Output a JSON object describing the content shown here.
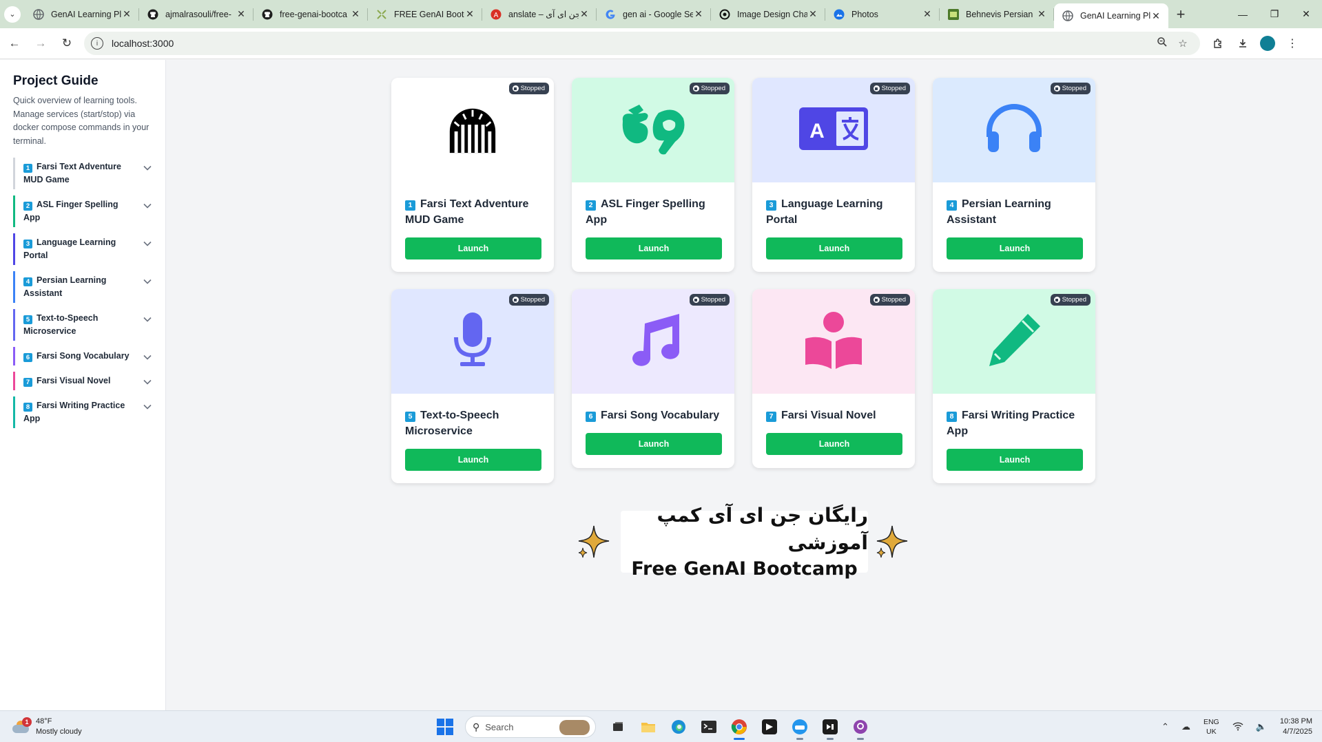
{
  "browser": {
    "tabs": [
      {
        "title": "GenAI Learning Pl",
        "favicon": "globe-icon",
        "color": "#5f6368"
      },
      {
        "title": "ajmalrasouli/free-",
        "favicon": "github-icon",
        "color": "#1f1f1f"
      },
      {
        "title": "free-genai-bootca",
        "favicon": "github-icon",
        "color": "#1f1f1f"
      },
      {
        "title": "FREE GenAI Bootc",
        "favicon": "puzzle-icon",
        "color": "#8aa84e"
      },
      {
        "title": "anslate – جن ای آی",
        "favicon": "translate-icon",
        "color": "#d93025"
      },
      {
        "title": "gen ai - Google Se",
        "favicon": "google-icon",
        "color": "#4285f4"
      },
      {
        "title": "Image Design Cha",
        "favicon": "openai-icon",
        "color": "#111111"
      },
      {
        "title": "Photos",
        "favicon": "photos-icon",
        "color": "#1a73e8"
      },
      {
        "title": "Behnevis Persian",
        "favicon": "behnevis-icon",
        "color": "#4d7a2a"
      },
      {
        "title": "GenAI Learning Pl",
        "favicon": "globe-icon",
        "color": "#5f6368",
        "active": true
      }
    ],
    "url": "localhost:3000"
  },
  "sidebar": {
    "title": "Project Guide",
    "description": "Quick overview of learning tools. Manage services (start/stop) via docker compose commands in your terminal.",
    "items": [
      {
        "num": "1",
        "label": "Farsi Text Adventure MUD Game",
        "bar_color": "#d1d5db"
      },
      {
        "num": "2",
        "label": "ASL Finger Spelling App",
        "bar_color": "#10b981"
      },
      {
        "num": "3",
        "label": "Language Learning Portal",
        "bar_color": "#4f46e5"
      },
      {
        "num": "4",
        "label": "Persian Learning Assistant",
        "bar_color": "#3b82f6"
      },
      {
        "num": "5",
        "label": "Text-to-Speech Microservice",
        "bar_color": "#6366f1"
      },
      {
        "num": "6",
        "label": "Farsi Song Vocabulary",
        "bar_color": "#8b5cf6"
      },
      {
        "num": "7",
        "label": "Farsi Visual Novel",
        "bar_color": "#ec4899"
      },
      {
        "num": "8",
        "label": "Farsi Writing Practice App",
        "bar_color": "#14b8a6"
      }
    ]
  },
  "cards": [
    {
      "num": "1",
      "title": "Farsi Text Adventure MUD Game",
      "status": "Stopped",
      "button": "Launch",
      "icon": "dungeon-icon",
      "bg": "#ffffff",
      "icon_color": "#000000"
    },
    {
      "num": "2",
      "title": "ASL Finger Spelling App",
      "status": "Stopped",
      "button": "Launch",
      "icon": "sign-language-icon",
      "bg": "#d1fae5",
      "icon_color": "#10b981"
    },
    {
      "num": "3",
      "title": "Language Learning Portal",
      "status": "Stopped",
      "button": "Launch",
      "icon": "language-icon",
      "bg": "#e0e7ff",
      "icon_color": "#4f46e5"
    },
    {
      "num": "4",
      "title": "Persian Learning Assistant",
      "status": "Stopped",
      "button": "Launch",
      "icon": "headphones-icon",
      "bg": "#dbeafe",
      "icon_color": "#3b82f6"
    },
    {
      "num": "5",
      "title": "Text-to-Speech Microservice",
      "status": "Stopped",
      "button": "Launch",
      "icon": "microphone-icon",
      "bg": "#e0e7ff",
      "icon_color": "#6366f1"
    },
    {
      "num": "6",
      "title": "Farsi Song Vocabulary",
      "status": "Stopped",
      "button": "Launch",
      "icon": "music-icon",
      "bg": "#ede9fe",
      "icon_color": "#8b5cf6"
    },
    {
      "num": "7",
      "title": "Farsi Visual Novel",
      "status": "Stopped",
      "button": "Launch",
      "icon": "book-reader-icon",
      "bg": "#fce7f3",
      "icon_color": "#ec4899"
    },
    {
      "num": "8",
      "title": "Farsi Writing Practice App",
      "status": "Stopped",
      "button": "Launch",
      "icon": "pencil-icon",
      "bg": "#d1fae5",
      "icon_color": "#10b981"
    }
  ],
  "banner": {
    "farsi": "رایگان جن ای آی کمپ آموزشی",
    "english": "Free GenAI Bootcamp"
  },
  "taskbar": {
    "weather_temp": "48°F",
    "weather_desc": "Mostly cloudy",
    "weather_badge": "1",
    "search_placeholder": "Search",
    "lang_line1": "ENG",
    "lang_line2": "UK",
    "time": "10:38 PM",
    "date": "4/7/2025"
  }
}
